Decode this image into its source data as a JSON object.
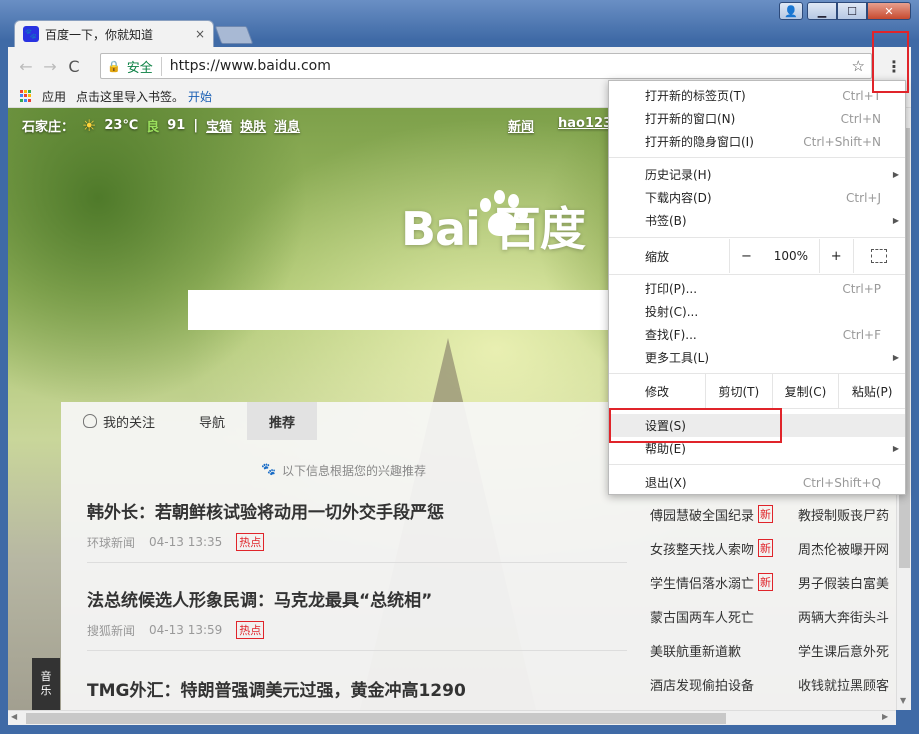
{
  "window": {
    "user_glyph": "👤",
    "min_glyph": "▁",
    "max_glyph": "☐",
    "close_glyph": "✕"
  },
  "tab": {
    "favicon_glyph": "🐾",
    "title": "百度一下，你就知道",
    "close_glyph": "×"
  },
  "toolbar": {
    "back_glyph": "←",
    "forward_glyph": "→",
    "reload_glyph": "C",
    "secure_label": "安全",
    "url": "https://www.baidu.com",
    "star_glyph": "☆",
    "menu_glyph": "⋮"
  },
  "bookmarks": {
    "apps": "应用",
    "import_hint": "点击这里导入书签。",
    "start": "开始"
  },
  "page": {
    "city": "石家庄：",
    "temp": "23℃",
    "aq_label": "良",
    "aq_value": "91",
    "sep": "|",
    "links_left": [
      "宝箱",
      "换肤",
      "消息"
    ],
    "links_right": [
      "新闻",
      "hao123"
    ],
    "logo": "Bai  百度",
    "feed_tabs": [
      "我的关注",
      "导航",
      "推荐"
    ],
    "recommend_tip": "以下信息根据您的兴趣推荐",
    "news": [
      {
        "headline": "韩外长：若朝鲜核试验将动用一切外交手段严惩",
        "source": "环球新闻",
        "time": "04-13 13:35",
        "tag": "热点"
      },
      {
        "headline": "法总统候选人形象民调：马克龙最具“总统相”",
        "source": "搜狐新闻",
        "time": "04-13 13:59",
        "tag": "热点"
      },
      {
        "headline": "TMG外汇：特朗普强调美元过强，黄金冲高1290",
        "source": "",
        "time": "",
        "tag": ""
      }
    ],
    "trends": [
      {
        "left": "傅园慧破全国纪录",
        "left_new": "新",
        "right": "教授制贩丧尸药"
      },
      {
        "left": "女孩整天找人索吻",
        "left_new": "新",
        "right": "周杰伦被曝开网"
      },
      {
        "left": "学生情侣落水溺亡",
        "left_new": "新",
        "right": "男子假装白富美"
      },
      {
        "left": "蒙古国两车人死亡",
        "left_new": "",
        "right": "两辆大奔街头斗"
      },
      {
        "left": "美联航重新道歉",
        "left_new": "",
        "right": "学生课后意外死"
      },
      {
        "left": "酒店发现偷拍设备",
        "left_new": "",
        "right": "收钱就拉黑顾客"
      }
    ],
    "music": [
      "音",
      "乐"
    ]
  },
  "menu": {
    "new_tab": {
      "label": "打开新的标签页(T)",
      "shortcut": "Ctrl+T"
    },
    "new_window": {
      "label": "打开新的窗口(N)",
      "shortcut": "Ctrl+N"
    },
    "incognito": {
      "label": "打开新的隐身窗口(I)",
      "shortcut": "Ctrl+Shift+N"
    },
    "history": {
      "label": "历史记录(H)"
    },
    "downloads": {
      "label": "下载内容(D)",
      "shortcut": "Ctrl+J"
    },
    "bookmarks": {
      "label": "书签(B)"
    },
    "zoom": {
      "label": "缩放",
      "minus": "−",
      "value": "100%",
      "plus": "+"
    },
    "print": {
      "label": "打印(P)...",
      "shortcut": "Ctrl+P"
    },
    "cast": {
      "label": "投射(C)..."
    },
    "find": {
      "label": "查找(F)...",
      "shortcut": "Ctrl+F"
    },
    "more_tools": {
      "label": "更多工具(L)"
    },
    "edit": {
      "label": "修改",
      "cut": "剪切(T)",
      "copy": "复制(C)",
      "paste": "粘贴(P)"
    },
    "settings": {
      "label": "设置(S)"
    },
    "help": {
      "label": "帮助(E)"
    },
    "exit": {
      "label": "退出(X)",
      "shortcut": "Ctrl+Shift+Q"
    },
    "submenu_arrow": "▶"
  },
  "scroll": {
    "up": "▲",
    "down": "▼",
    "left": "◀",
    "right": "▶"
  },
  "colors": {
    "highlight_red": "#e0242a",
    "secure_green": "#0b8043",
    "link_blue": "#1a5fb4"
  }
}
